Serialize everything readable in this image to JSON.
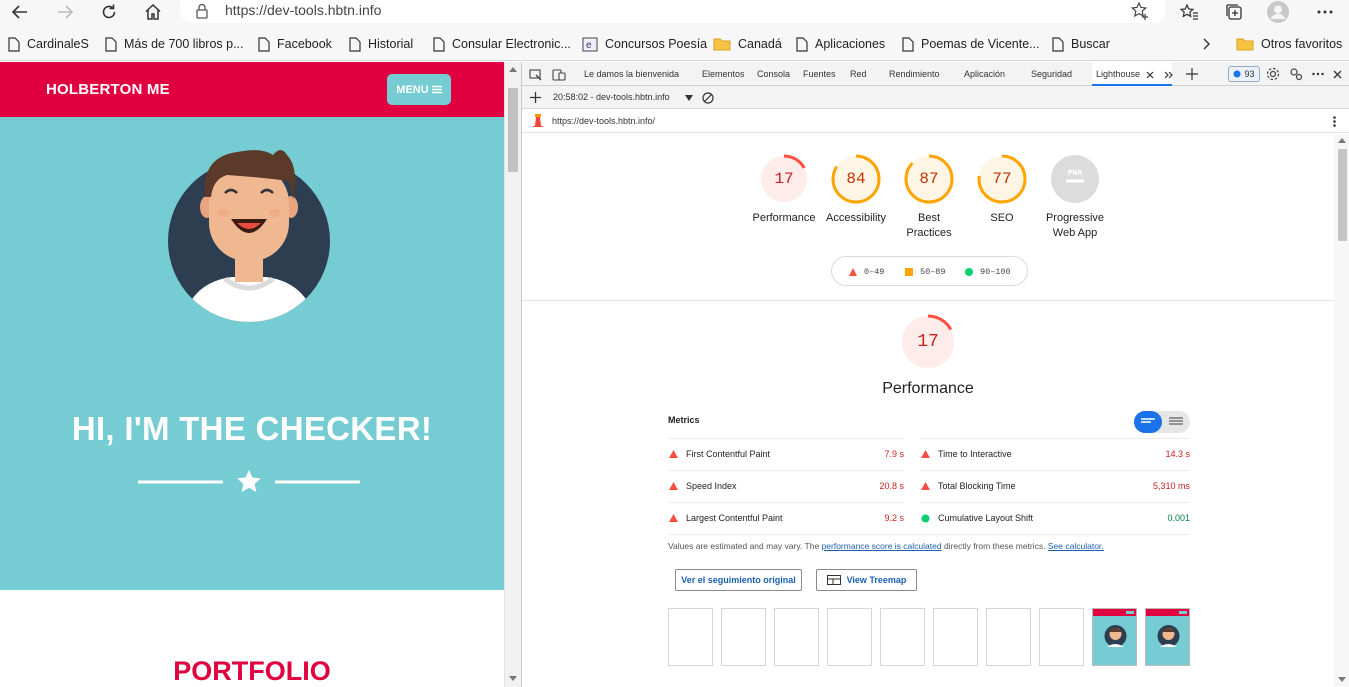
{
  "browser": {
    "url": "https://dev-tools.hbtn.info",
    "bookmarks": [
      {
        "label": "CardinaleS",
        "icon": "page-icon"
      },
      {
        "label": "Más de 700 libros p...",
        "icon": "page-icon"
      },
      {
        "label": "Facebook",
        "icon": "page-icon"
      },
      {
        "label": "Historial",
        "icon": "page-icon"
      },
      {
        "label": "Consular Electronic...",
        "icon": "page-icon"
      },
      {
        "label": "Concursos Poesía",
        "icon": "edge-icon"
      },
      {
        "label": "Canadá",
        "icon": "folder-icon"
      },
      {
        "label": "Aplicaciones",
        "icon": "page-icon"
      },
      {
        "label": "Poemas de Vicente...",
        "icon": "page-icon"
      },
      {
        "label": "Buscar",
        "icon": "page-icon"
      }
    ],
    "other_favorites": "Otros favoritos"
  },
  "site": {
    "brand": "HOLBERTON ME",
    "menu_label": "MENU",
    "hero_title": "HI, I'M THE CHECKER!",
    "portfolio_title": "PORTFOLIO",
    "colors": {
      "primary": "#e1003f",
      "hero_bg": "#76ccd3"
    }
  },
  "devtools": {
    "tabs": [
      "Le damos la bienvenida",
      "Elementos",
      "Consola",
      "Fuentes",
      "Red",
      "Rendimiento",
      "Aplicación",
      "Seguridad",
      "Lighthouse"
    ],
    "active_tab": "Lighthouse",
    "issues_count": "93",
    "report_select": "20:58:02 - dev-tools.hbtn.info",
    "report_url": "https://dev-tools.hbtn.info/"
  },
  "lighthouse": {
    "categories": [
      {
        "label": "Performance",
        "score": "17",
        "status": "fail"
      },
      {
        "label": "Accessibility",
        "score": "84",
        "status": "average"
      },
      {
        "label": "Best Practices",
        "score": "87",
        "status": "average"
      },
      {
        "label": "SEO",
        "score": "77",
        "status": "average"
      },
      {
        "label": "Progressive Web App",
        "score": "PWA",
        "status": "na"
      }
    ],
    "legend": [
      {
        "range": "0–49",
        "status": "fail"
      },
      {
        "range": "50–89",
        "status": "average"
      },
      {
        "range": "90–100",
        "status": "pass"
      }
    ],
    "colors": {
      "fail": "#ff4e42",
      "average": "#ffa400",
      "pass": "#0cce6b"
    },
    "performance": {
      "score": "17",
      "title": "Performance",
      "metrics_heading": "Metrics",
      "metrics_left": [
        {
          "label": "First Contentful Paint",
          "value": "7.9 s",
          "status": "fail"
        },
        {
          "label": "Speed Index",
          "value": "20.8 s",
          "status": "fail"
        },
        {
          "label": "Largest Contentful Paint",
          "value": "9.2 s",
          "status": "fail"
        }
      ],
      "metrics_right": [
        {
          "label": "Time to Interactive",
          "value": "14.3 s",
          "status": "fail"
        },
        {
          "label": "Total Blocking Time",
          "value": "5,310 ms",
          "status": "fail"
        },
        {
          "label": "Cumulative Layout Shift",
          "value": "0.001",
          "status": "pass"
        }
      ],
      "disclaimer_prefix": "Values are estimated and may vary. The",
      "disclaimer_link1": "performance score is calculated",
      "disclaimer_mid": "directly from these metrics.",
      "disclaimer_link2": "See calculator.",
      "trace_button": "Ver el seguimiento original",
      "treemap_button": "View Treemap",
      "filmstrip_frames": 10
    }
  }
}
